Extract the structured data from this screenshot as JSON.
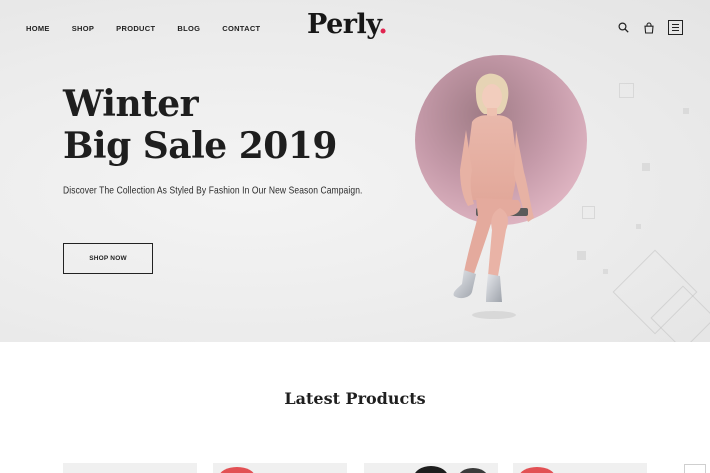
{
  "brand": {
    "name": "Perly",
    "dot": "."
  },
  "nav": {
    "items": [
      {
        "label": "HOME"
      },
      {
        "label": "SHOP"
      },
      {
        "label": "PRODUCT"
      },
      {
        "label": "BLOG"
      },
      {
        "label": "CONTACT"
      }
    ]
  },
  "header_icons": [
    "search-icon",
    "shopping-bag-icon",
    "menu-icon"
  ],
  "hero": {
    "title_line1": "Winter",
    "title_line2": "Big Sale 2019",
    "subtitle": "Discover The Collection As Styled By Fashion In Our New Season Campaign.",
    "cta_label": "SHOP NOW"
  },
  "latest": {
    "title": "Latest Products"
  },
  "colors": {
    "accent": "#e0244f",
    "text": "#1e1e1e",
    "hero_bg": "#ececec",
    "circle": "#c59aa9"
  }
}
